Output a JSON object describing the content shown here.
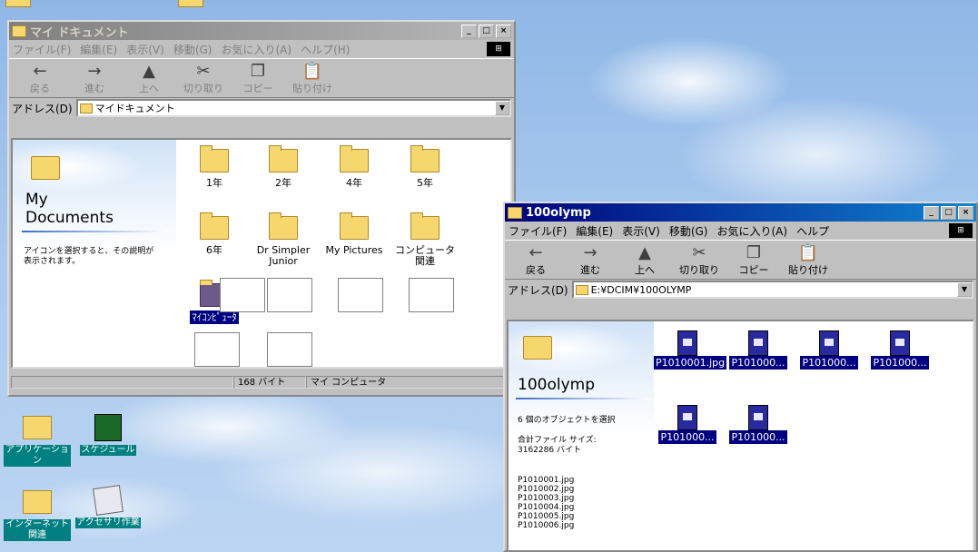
{
  "window1": {
    "title": "マイ ドキュメント",
    "title_buttons": [
      "_",
      "□",
      "×"
    ],
    "menu": [
      "ファイル(F)",
      "編集(E)",
      "表示(V)",
      "移動(G)",
      "お気に入り(A)",
      "ヘルプ(H)"
    ],
    "toolbar": [
      {
        "label": "戻る",
        "icon": "back-arrow-icon",
        "glyph": "←"
      },
      {
        "label": "進む",
        "icon": "forward-arrow-icon",
        "glyph": "→"
      },
      {
        "label": "上へ",
        "icon": "up-folder-icon",
        "glyph": "▲"
      },
      {
        "label": "切り取り",
        "icon": "scissors-icon",
        "glyph": "✂"
      },
      {
        "label": "コピー",
        "icon": "copy-icon",
        "glyph": "❐"
      },
      {
        "label": "貼り付け",
        "icon": "paste-icon",
        "glyph": "📋"
      }
    ],
    "address_label": "アドレス(D)",
    "address_value": "マイドキュメント",
    "panel": {
      "title_line1": "My",
      "title_line2": "Documents",
      "hint": "アイコンを選択すると、その説明が表示されます。"
    },
    "folders": [
      "1年",
      "2年",
      "4年",
      "5年",
      "6年",
      "Dr Simpler Junior",
      "My Pictures",
      "コンピュータ関連"
    ],
    "selected_item": "ﾏｲｺﾝﾋﾟｭｰﾀ",
    "status": {
      "size": "168 バイト",
      "location": "マイ コンピュータ"
    }
  },
  "window2": {
    "title": "100olymp",
    "title_buttons": [
      "_",
      "□",
      "×"
    ],
    "menu": [
      "ファイル(F)",
      "編集(E)",
      "表示(V)",
      "移動(G)",
      "お気に入り(A)",
      "ヘルプ"
    ],
    "toolbar": [
      {
        "label": "戻る",
        "icon": "back-arrow-icon",
        "glyph": "←"
      },
      {
        "label": "進む",
        "icon": "forward-arrow-icon",
        "glyph": "→"
      },
      {
        "label": "上へ",
        "icon": "up-folder-icon",
        "glyph": "▲"
      },
      {
        "label": "切り取り",
        "icon": "scissors-icon",
        "glyph": "✂"
      },
      {
        "label": "コピー",
        "icon": "copy-icon",
        "glyph": "❐"
      },
      {
        "label": "貼り付け",
        "icon": "paste-icon",
        "glyph": "📋"
      }
    ],
    "address_label": "アドレス(D)",
    "address_value": "E:¥DCIM¥100OLYMP",
    "panel": {
      "title": "100olymp",
      "selection_count": "6 個のオブジェクトを選択",
      "size_label": "合計ファイル サイズ:",
      "size_value": "3162286 バイト",
      "file_list": [
        "P1010001.jpg",
        "P1010002.jpg",
        "P1010003.jpg",
        "P1010004.jpg",
        "P1010005.jpg",
        "P1010006.jpg"
      ]
    },
    "files": [
      "P1010001.jpg",
      "P101000...",
      "P101000...",
      "P101000...",
      "P101000...",
      "P101000..."
    ]
  },
  "desktop": {
    "icons": [
      {
        "label": "アプリケーション",
        "icon": "folder-icon"
      },
      {
        "label": "スケジュール",
        "icon": "scheduler-icon"
      },
      {
        "label": "インターネット関連",
        "icon": "folder-icon"
      },
      {
        "label": "アクセサリ作業",
        "icon": "notepad-icon"
      }
    ]
  }
}
